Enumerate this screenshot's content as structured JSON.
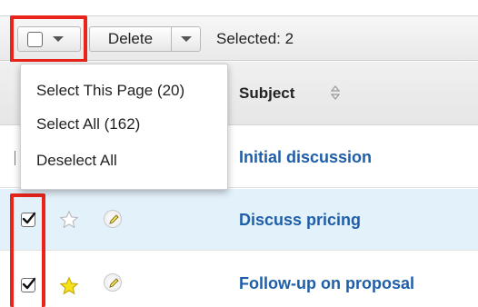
{
  "toolbar": {
    "delete_label": "Delete",
    "selected_text": "Selected: 2"
  },
  "table": {
    "subject_header": "Subject",
    "rows": [
      {
        "subject": "Initial discussion",
        "checked": false,
        "favorite": false
      },
      {
        "subject": "Discuss pricing",
        "checked": true,
        "favorite": false
      },
      {
        "subject": "Follow-up on proposal",
        "checked": true,
        "favorite": true
      }
    ]
  },
  "menu": {
    "items": [
      {
        "label": "Select This Page (20)"
      },
      {
        "label": "Select All (162)"
      },
      {
        "label": "Deselect All"
      }
    ]
  },
  "icons": {
    "select_checkbox": "checkbox-icon",
    "dropdown": "chevron-down-icon",
    "sort": "sort-icon",
    "favorite": "star-icon",
    "edit": "pencil-icon",
    "checked": "checkmark-icon"
  },
  "colors": {
    "highlight": "#e8241b",
    "link": "#1f5ea8",
    "selected_row": "#e3f1fb",
    "favorite_star": "#f5e21a"
  }
}
